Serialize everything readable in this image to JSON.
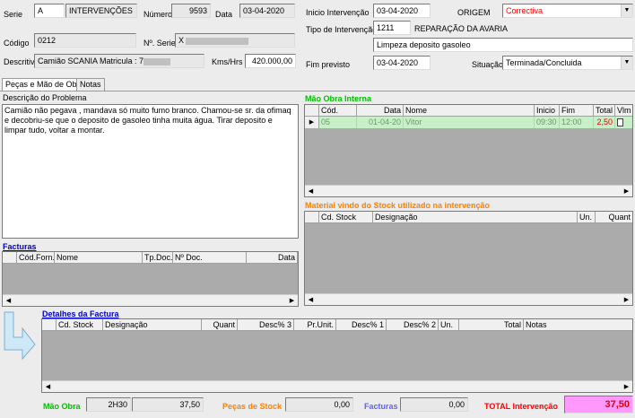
{
  "header": {
    "serie_label": "Serie",
    "serie_value": "A",
    "serie_name": "INTERVENÇÕES",
    "numero_label": "Número",
    "numero_value": "9593",
    "data_label": "Data",
    "data_value": "03-04-2020",
    "codigo_label": "Código",
    "codigo_value": "0212",
    "nserie_label": "Nº. Serie",
    "nserie_value": "X",
    "descritivo_label": "Descritivo",
    "descritivo_value": "Camião SCANIA Matricula : 7",
    "kms_label": "Kms/Hrs",
    "kms_value": "420.000,00"
  },
  "intervention": {
    "inicio_label": "Inicio Intervenção",
    "inicio_value": "03-04-2020",
    "origem_label": "ORIGEM",
    "origem_value": "Correctiva",
    "tipo_label": "Tipo de Intervenção",
    "tipo_code": "1211",
    "tipo_name": "REPARAÇÃO DA AVARIA",
    "tipo_desc": "Limpeza deposito gasoleo",
    "fim_label": "Fim previsto",
    "fim_value": "03-04-2020",
    "situacao_label": "Situação",
    "situacao_value": "Terminada/Concluida"
  },
  "tabs": [
    {
      "label": "Peças e Mão de Obra"
    },
    {
      "label": "Notas"
    }
  ],
  "problem": {
    "title": "Descrição do Problema",
    "text": "Camião não pegava , mandava só muito fumo branco. Chamou-se sr. da ofimaq e decobriu-se que o deposito de gasoleo tinha muita água.  Tirar deposito e limpar tudo, voltar a montar."
  },
  "facturas": {
    "title": "Facturas",
    "columns": [
      "Cód.Forn.",
      "Nome",
      "Tp.Doc.",
      "Nº Doc.",
      "Data"
    ]
  },
  "mao_obra": {
    "title": "Mão Obra Interna",
    "columns": [
      "Cód.",
      "Data",
      "Nome",
      "Inicio",
      "Fim",
      "Total",
      "Vlm"
    ],
    "rows": [
      {
        "cod": "05",
        "data": "01-04-20",
        "nome": "Vitor",
        "inicio": "09:30",
        "fim": "12:00",
        "total": "2,50"
      }
    ]
  },
  "material": {
    "title": "Material vindo do Stock utilizado na intervenção",
    "columns": [
      "Cd. Stock",
      "Designação",
      "Un.",
      "Quant"
    ]
  },
  "detalhes": {
    "title": "Detalhes da Factura",
    "columns": [
      "Cd. Stock",
      "Designação",
      "Quant",
      "Desc% 3",
      "Pr.Unit.",
      "Desc% 1",
      "Desc% 2",
      "Un.",
      "Total",
      "Notas"
    ]
  },
  "totals": {
    "mao_obra_label": "Mão Obra",
    "mao_obra_hours": "2H30",
    "mao_obra_value": "37,50",
    "pecas_label": "Peças de Stock",
    "pecas_value": "0,00",
    "facturas_label": "Facturas",
    "facturas_value": "0,00",
    "total_label": "TOTAL Intervenção",
    "total_value": "37,50"
  },
  "colors": {
    "mao_obra_title": "#00c000",
    "material_title": "#ff8000",
    "facturas_title": "#0000cc",
    "facturas_total_label": "#6060ff",
    "total_label": "#ff0000",
    "total_bg": "#ff99ff",
    "row_highlight": "#c8f0c8",
    "origem_text": "#ff0000"
  }
}
